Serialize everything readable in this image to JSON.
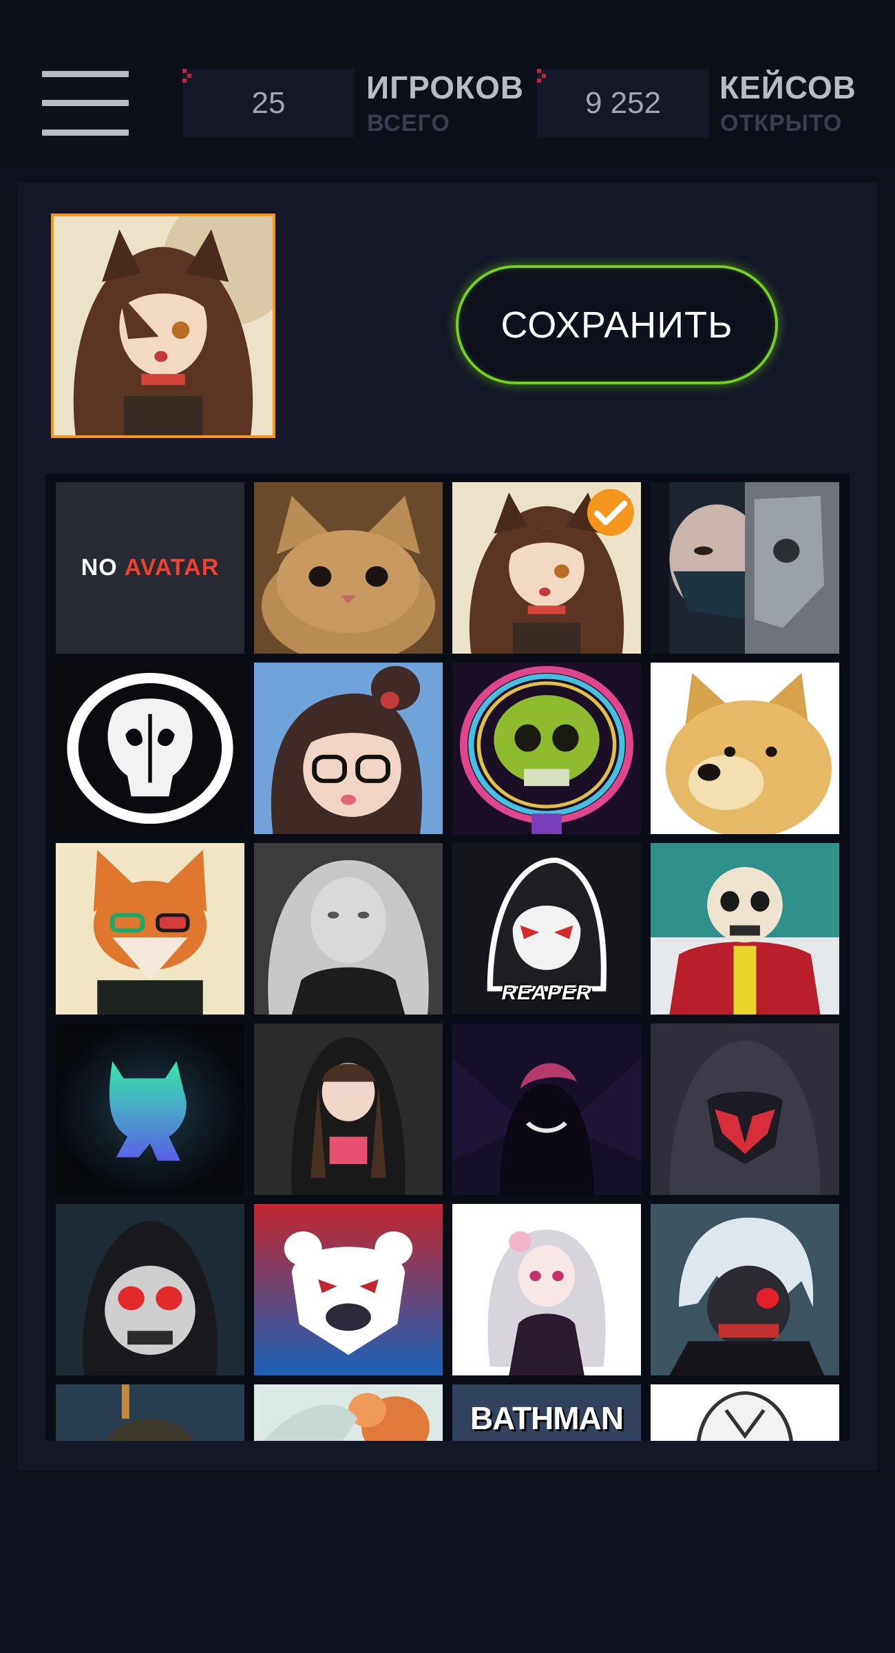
{
  "header": {
    "menu_icon": "hamburger-menu-icon",
    "stats": [
      {
        "value": "25",
        "title": "ИГРОКОВ",
        "subtitle": "ВСЕГО"
      },
      {
        "value": "9 252",
        "title": "КЕЙСОВ",
        "subtitle": "ОТКРЫТО"
      }
    ]
  },
  "profile": {
    "current_avatar": "anime-cat-girl-avatar",
    "save_label": "СОХРАНИТЬ"
  },
  "avatars": {
    "no_avatar": {
      "word1": "NO",
      "word2": "AVATAR"
    },
    "selected": "anime-cat-girl",
    "reaper_label": "REAPER",
    "bathman_label": "BATHMAN"
  },
  "colors": {
    "accent_orange": "#f4951c",
    "save_green": "#76d11f",
    "background": "#0e111c",
    "panel": "#141827",
    "red_marker": "#c4203f"
  }
}
